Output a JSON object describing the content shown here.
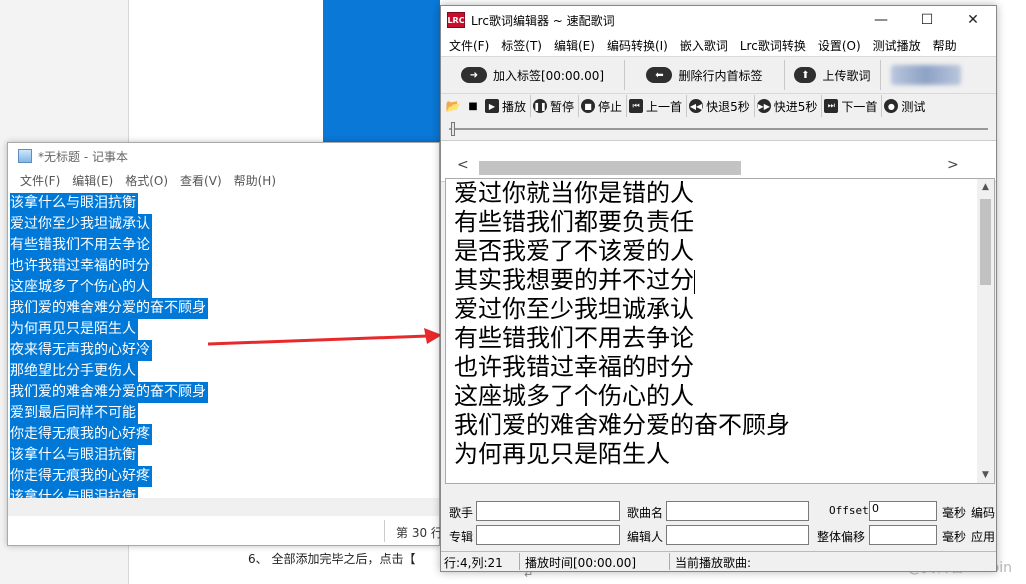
{
  "background": {
    "doc_line": "6、 全部添加完毕之后，点击【",
    "doc_return_mark": "↵",
    "watermark": "CSDN @资料君Runbin"
  },
  "notepad": {
    "title": "*无标题 - 记事本",
    "menu": [
      "文件(F)",
      "编辑(E)",
      "格式(O)",
      "查看(V)",
      "帮助(H)"
    ],
    "lines": [
      "该拿什么与眼泪抗衡",
      "爱过你至少我坦诚承认",
      "有些错我们不用去争论",
      "也许我错过幸福的时分",
      "这座城多了个伤心的人",
      "我们爱的难舍难分爱的奋不顾身",
      "为何再见只是陌生人",
      "夜来得无声我的心好冷",
      "那绝望比分手更伤人",
      "我们爱的难舍难分爱的奋不顾身",
      "爱到最后同样不可能",
      "你走得无痕我的心好疼",
      "该拿什么与眼泪抗衡",
      "你走得无痕我的心好疼",
      "该拿什么与眼泪抗衡"
    ],
    "status": "第 30 行"
  },
  "lrc": {
    "logo": "LRC",
    "title": "Lrc歌词编辑器 ~ 速配歌词",
    "window_buttons": {
      "minimize": "—",
      "maximize": "☐",
      "close": "✕"
    },
    "menu": [
      "文件(F)",
      "标签(T)",
      "编辑(E)",
      "编码转换(I)",
      "嵌入歌词",
      "Lrc歌词转换",
      "设置(O)",
      "测试播放",
      "帮助"
    ],
    "big_toolbar": {
      "add_tag": "加入标签[00:00.00]",
      "delete_tag": "删除行内首标签",
      "upload": "上传歌词"
    },
    "small_toolbar": {
      "play": "播放",
      "pause": "暂停",
      "stop": "停止",
      "prev": "上一首",
      "rewind": "快退5秒",
      "forward": "快进5秒",
      "next": "下一首",
      "test": "测试"
    },
    "preview": {
      "left_arrow": "<",
      "right_arrow": ">"
    },
    "editor_lines": [
      "爱过你就当你是错的人",
      "有些错我们都要负责任",
      "是否我爱了不该爱的人",
      "其实我想要的并不过分",
      "爱过你至少我坦诚承认",
      "有些错我们不用去争论",
      "也许我错过幸福的时分",
      "这座城多了个伤心的人",
      "我们爱的难舍难分爱的奋不顾身",
      "为何再见只是陌生人"
    ],
    "fields": {
      "artist_label": "歌手",
      "song_label": "歌曲名",
      "offset_label": "Offset",
      "offset_value": "0",
      "ms_label_1": "毫秒",
      "encode_label": "编码",
      "album_label": "专辑",
      "editor_label": "编辑人",
      "overall_offset_label": "整体偏移",
      "ms_label_2": "毫秒",
      "apply_label": "应用"
    },
    "status": {
      "position": "行:4,列:21",
      "play_time": "播放时间[00:00.00]",
      "now_playing": "当前播放歌曲:"
    }
  }
}
